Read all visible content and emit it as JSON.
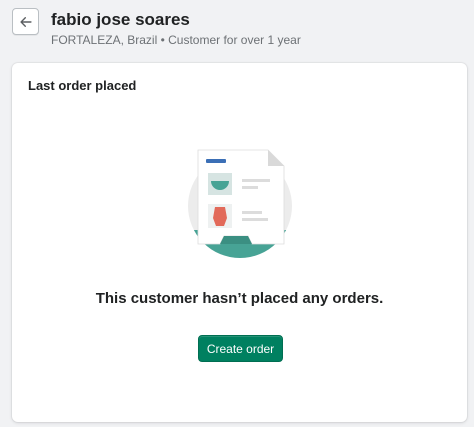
{
  "header": {
    "back_icon": "arrow-left-icon",
    "title": "fabio jose soares",
    "subtitle": "FORTALEZA, Brazil • Customer for over 1 year"
  },
  "card": {
    "title": "Last order placed",
    "illustration_icon": "empty-orders-illustration",
    "empty_heading": "This customer hasn’t placed any orders.",
    "create_order_label": "Create order"
  },
  "colors": {
    "page_bg": "#f1f2f4",
    "primary_button": "#008060",
    "illustration_teal": "#47a395"
  }
}
